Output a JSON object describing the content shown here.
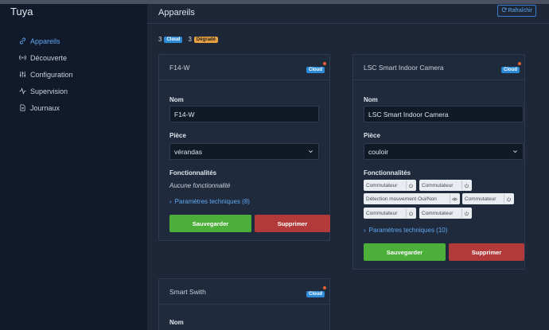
{
  "app": {
    "title": "Tuya"
  },
  "sidebar": {
    "items": [
      {
        "label": "Appareils",
        "icon": "link-icon",
        "active": true
      },
      {
        "label": "Découverte",
        "icon": "broadcast-icon",
        "active": false
      },
      {
        "label": "Configuration",
        "icon": "sliders-icon",
        "active": false
      },
      {
        "label": "Supervision",
        "icon": "activity-icon",
        "active": false
      },
      {
        "label": "Journaux",
        "icon": "document-icon",
        "active": false
      }
    ]
  },
  "header": {
    "title": "Appareils",
    "refresh_label": "Rafraîchir"
  },
  "counters": {
    "cloud_count": "3",
    "cloud_label": "Cloud",
    "degraded_count": "3",
    "degraded_label": "Dégradé"
  },
  "labels": {
    "name": "Nom",
    "room": "Pièce",
    "features": "Fonctionnalités",
    "save": "Sauvegarder",
    "delete": "Supprimer",
    "cloud_badge": "Cloud"
  },
  "devices": [
    {
      "title": "F14-W",
      "name_value": "F14-W",
      "room_value": "vérandas",
      "no_features": "Aucune fonctionnalité",
      "tech_params": "Paramètres techniques (8)"
    },
    {
      "title": "LSC Smart Indoor Camera",
      "name_value": "LSC Smart Indoor Camera",
      "room_value": "couloir",
      "features": [
        {
          "label": "Commutateur",
          "icon": "power-icon"
        },
        {
          "label": "Commutateur",
          "icon": "power-icon"
        },
        {
          "label": "Détection mouvement Oui/Non",
          "icon": "eye-icon"
        },
        {
          "label": "Commutateur",
          "icon": "power-icon"
        },
        {
          "label": "Commutateur",
          "icon": "power-icon"
        },
        {
          "label": "Commutateur",
          "icon": "power-icon"
        }
      ],
      "tech_params": "Paramètres techniques (10)"
    },
    {
      "title": "Smart Swith",
      "name_label": "Nom"
    }
  ],
  "colors": {
    "accent": "#5fa8f0",
    "save": "#4caf3a",
    "delete": "#b23a3a",
    "cloud_badge": "#2d8ad6",
    "degraded_badge": "#e6a040",
    "status_dot": "#e5602a"
  }
}
